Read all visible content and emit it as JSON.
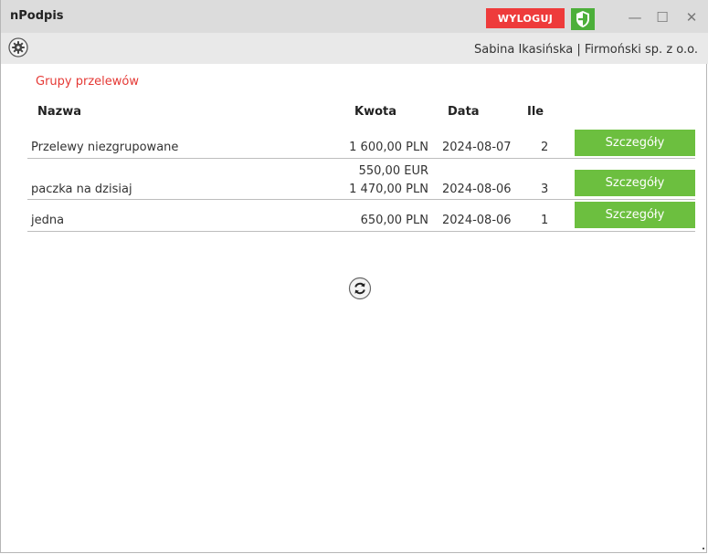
{
  "window": {
    "title": "nPodpis",
    "logout_label": "WYLOGUJ",
    "minimize_glyph": "—",
    "maximize_glyph": "☐",
    "close_glyph": "✕"
  },
  "toolbar": {
    "user_info": "Sabina Ikasińska  |  Firmoński sp. z o.o."
  },
  "main": {
    "section_title": "Grupy przelewów",
    "columns": [
      "Nazwa",
      "Kwota",
      "Data",
      "Ile"
    ],
    "rows": [
      {
        "name": "Przelewy niezgrupowane",
        "amounts": [
          "1 600,00 PLN"
        ],
        "date": "2024-08-07",
        "count": "2",
        "button": "Szczegóły"
      },
      {
        "name": "paczka na dzisiaj",
        "amounts": [
          "550,00 EUR",
          "1 470,00 PLN"
        ],
        "date": "2024-08-06",
        "count": "3",
        "button": "Szczegóły"
      },
      {
        "name": "jedna",
        "amounts": [
          "650,00 PLN"
        ],
        "date": "2024-08-06",
        "count": "1",
        "button": "Szczegóły"
      }
    ]
  },
  "colors": {
    "accent_red": "#ee3b3b",
    "section_title": "#e53935",
    "button_green": "#6cbf3f",
    "shield_green": "#4caf3a"
  },
  "icons": [
    "shield-icon",
    "gear-icon",
    "refresh-icon",
    "minimize-icon",
    "maximize-icon",
    "close-icon"
  ]
}
